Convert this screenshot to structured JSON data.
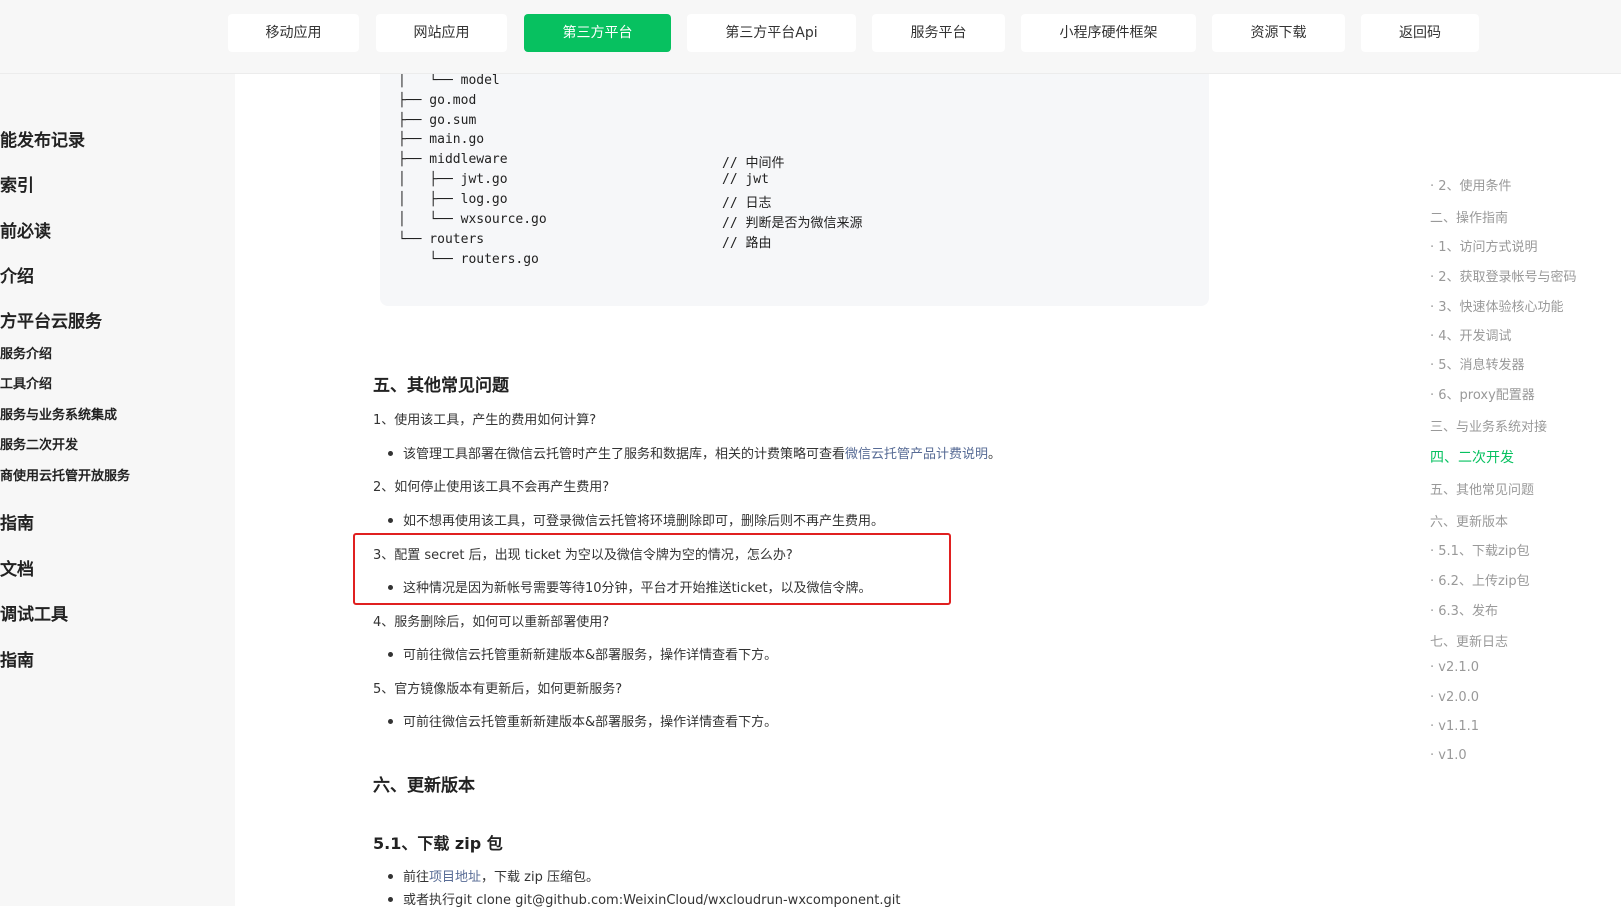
{
  "topnav": {
    "tabs": [
      {
        "label": "移动应用"
      },
      {
        "label": "网站应用"
      },
      {
        "label": "第三方平台",
        "active": true
      },
      {
        "label": "第三方平台Api"
      },
      {
        "label": "服务平台"
      },
      {
        "label": "小程序硬件框架"
      },
      {
        "label": "资源下载"
      },
      {
        "label": "返回码"
      }
    ]
  },
  "sidebar": {
    "items": [
      {
        "label": "能发布记录"
      },
      {
        "label": "索引"
      },
      {
        "label": "前必读"
      },
      {
        "label": "介绍"
      },
      {
        "label": "方平台云服务"
      },
      {
        "label": "服务介绍"
      },
      {
        "label": "工具介绍"
      },
      {
        "label": "服务与业务系统集成"
      },
      {
        "label": "服务二次开发"
      },
      {
        "label": "商使用云托管开放服务"
      },
      {
        "label": "指南"
      },
      {
        "label": "文档"
      },
      {
        "label": "调试工具"
      },
      {
        "label": "指南"
      }
    ]
  },
  "code": {
    "lines": [
      {
        "text": "│   └── model",
        "comment": ""
      },
      {
        "text": "├── go.mod",
        "comment": ""
      },
      {
        "text": "├── go.sum",
        "comment": ""
      },
      {
        "text": "├── main.go",
        "comment": ""
      },
      {
        "text": "├── middleware",
        "comment": "// 中间件"
      },
      {
        "text": "│   ├── jwt.go",
        "comment": "// jwt"
      },
      {
        "text": "│   ├── log.go",
        "comment": "// 日志"
      },
      {
        "text": "│   └── wxsource.go",
        "comment": "// 判断是否为微信来源"
      },
      {
        "text": "└── routers",
        "comment": "// 路由"
      },
      {
        "text": "    └── routers.go",
        "comment": ""
      }
    ]
  },
  "content": {
    "faq_heading": "五、其他常见问题",
    "q1": "1、使用该工具，产生的费用如何计算?",
    "a1_prefix": "该管理工具部署在微信云托管时产生了服务和数据库，相关的计费策略可查看",
    "a1_link": "微信云托管产品计费说明",
    "a1_suffix": "。",
    "q2": "2、如何停止使用该工具不会再产生费用?",
    "a2": "如不想再使用该工具，可登录微信云托管将环境删除即可，删除后则不再产生费用。",
    "q3": "3、配置 secret 后，出现 ticket 为空以及微信令牌为空的情况，怎么办?",
    "a3": "这种情况是因为新帐号需要等待10分钟，平台才开始推送ticket，以及微信令牌。",
    "q4": "4、服务删除后，如何可以重新部署使用?",
    "a4": "可前往微信云托管重新新建版本&部署服务，操作详情查看下方。",
    "q5": "5、官方镜像版本有更新后，如何更新服务?",
    "a5": "可前往微信云托管重新新建版本&部署服务，操作详情查看下方。",
    "update_heading": "六、更新版本",
    "download_heading": "5.1、下载 zip 包",
    "d1_prefix": "前往",
    "d1_link": "项目地址",
    "d1_suffix": "，下载 zip 压缩包。",
    "d2": "或者执行git clone git@github.com:WeixinCloud/wxcloudrun-wxcomponent.git"
  },
  "toc": {
    "items": [
      {
        "label": "· 2、使用条件"
      },
      {
        "label": "二、操作指南"
      },
      {
        "label": "· 1、访问方式说明"
      },
      {
        "label": "· 2、获取登录帐号与密码"
      },
      {
        "label": "· 3、快速体验核心功能"
      },
      {
        "label": "· 4、开发调试"
      },
      {
        "label": "· 5、消息转发器"
      },
      {
        "label": "· 6、proxy配置器"
      },
      {
        "label": "三、与业务系统对接"
      },
      {
        "label": "四、二次开发",
        "active": true
      },
      {
        "label": "五、其他常见问题"
      },
      {
        "label": "六、更新版本"
      },
      {
        "label": "· 5.1、下载zip包"
      },
      {
        "label": "· 6.2、上传zip包"
      },
      {
        "label": "· 6.3、发布"
      },
      {
        "label": "七、更新日志"
      },
      {
        "label": "· v2.1.0"
      },
      {
        "label": "· v2.0.0"
      },
      {
        "label": "· v1.1.1"
      },
      {
        "label": "· v1.0"
      }
    ]
  },
  "colors": {
    "accent": "#07c160",
    "highlight_border": "#e02020",
    "link": "#576b95"
  }
}
